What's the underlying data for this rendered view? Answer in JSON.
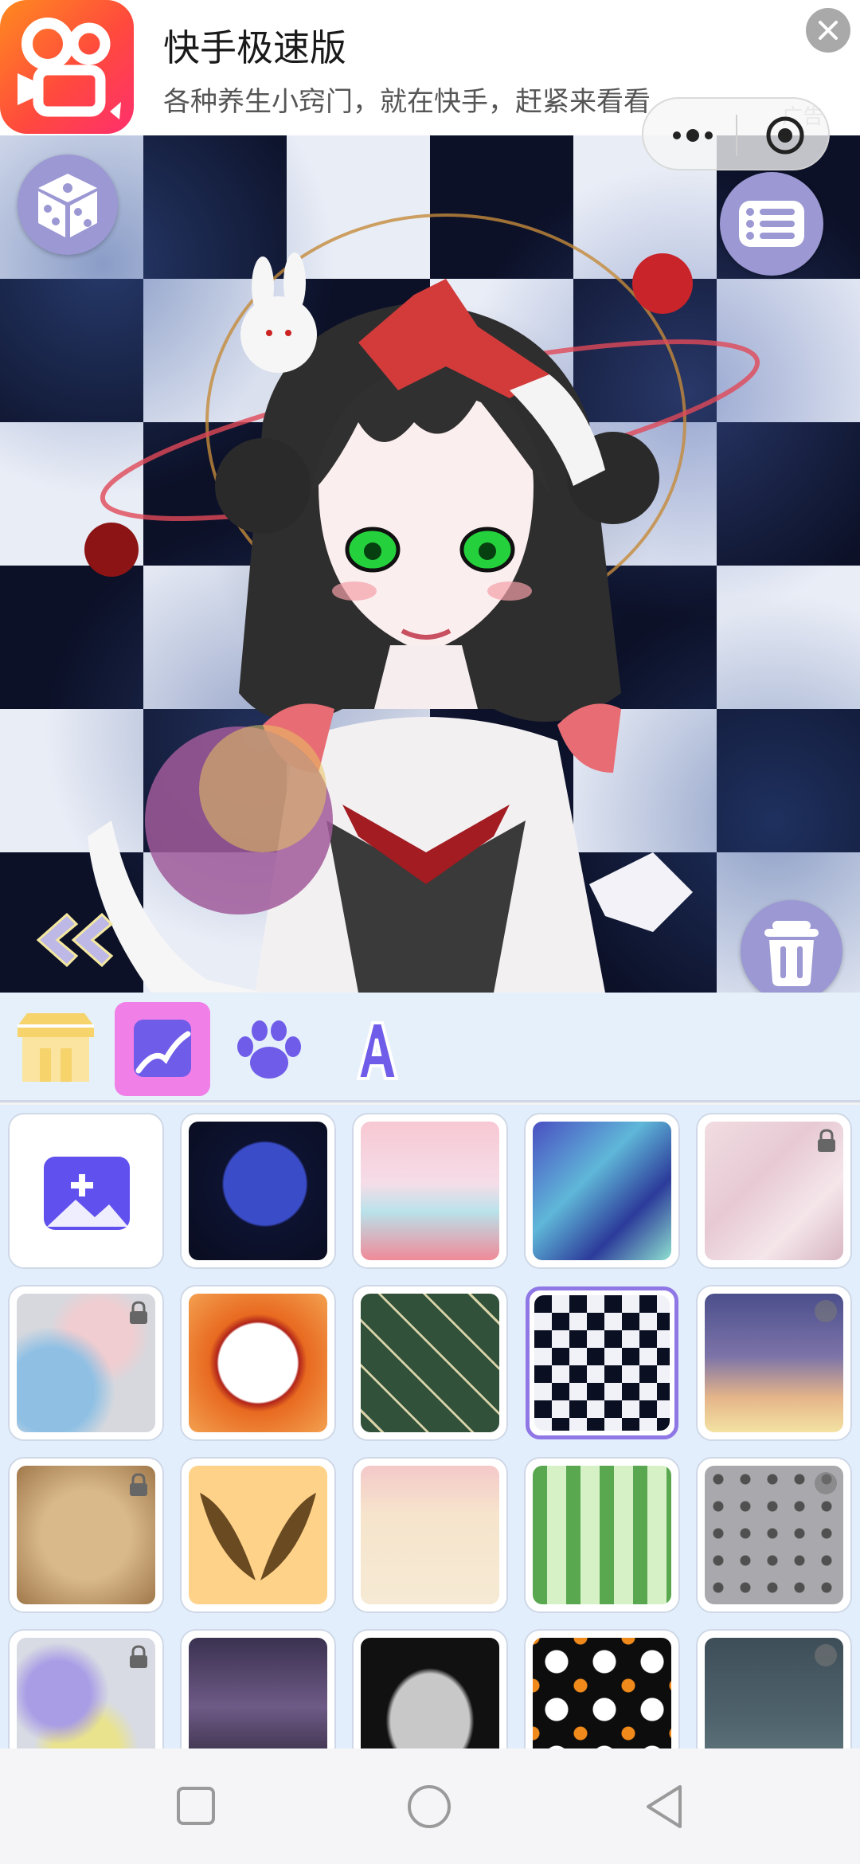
{
  "ad": {
    "title": "快手极速版",
    "subtitle": "各种养生小窍门，就在快手，赶紧来看看",
    "tag": "广告"
  },
  "canvas": {
    "background": "checkerboard-clouds",
    "character": "anime-girl-with-bow-and-orb"
  },
  "toolbar_icons": [
    "dice-icon",
    "menu-list-icon",
    "trash-icon",
    "back-chevron-icon"
  ],
  "tabs": [
    {
      "name": "shop-tab",
      "icon": "shop-icon",
      "active": false
    },
    {
      "name": "background-tab",
      "icon": "image-icon",
      "active": true
    },
    {
      "name": "pet-tab",
      "icon": "paw-icon",
      "active": false
    },
    {
      "name": "text-tab",
      "icon": "letter-a-icon",
      "active": false
    }
  ],
  "grid": {
    "items": [
      {
        "id": "upload",
        "kind": "upload"
      },
      {
        "id": "galaxy",
        "locked": false
      },
      {
        "id": "pastel-clouds",
        "locked": false
      },
      {
        "id": "swirl-lines",
        "locked": false
      },
      {
        "id": "marble-pink",
        "locked": true
      },
      {
        "id": "watercolor-blue",
        "locked": true
      },
      {
        "id": "orange-frame",
        "locked": false
      },
      {
        "id": "green-pattern",
        "locked": false
      },
      {
        "id": "checkerboard",
        "locked": false,
        "selected": true
      },
      {
        "id": "sunset-sky",
        "video": true
      },
      {
        "id": "old-paper",
        "locked": true
      },
      {
        "id": "wings",
        "locked": false
      },
      {
        "id": "floral-cream",
        "locked": false
      },
      {
        "id": "green-leaves",
        "locked": false
      },
      {
        "id": "skull-grey",
        "video": true
      },
      {
        "id": "paint-splash",
        "locked": true
      },
      {
        "id": "purple-mountains",
        "locked": false
      },
      {
        "id": "halloween-frame",
        "locked": false
      },
      {
        "id": "ghosts",
        "locked": false
      },
      {
        "id": "night-moon",
        "video": true
      }
    ]
  },
  "colors": {
    "accent": "#8f78e6",
    "active_tab": "#f07fe8",
    "button": "#9b98d3",
    "panel": "#e2eefb"
  }
}
